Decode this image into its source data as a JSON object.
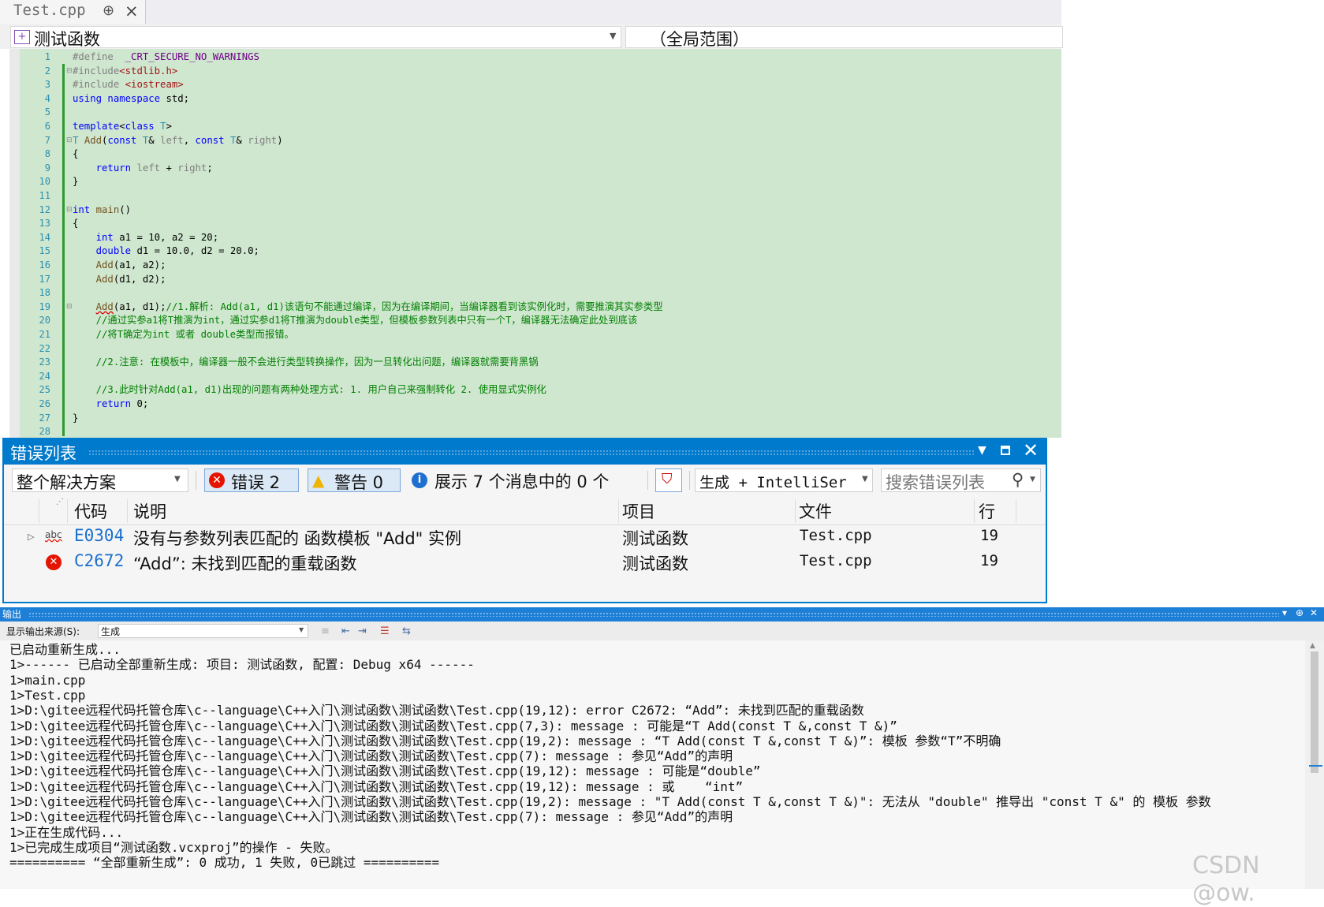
{
  "editor": {
    "tab_title": "Test.cpp",
    "tab_pin_icon": "pin-icon",
    "tab_close_icon": "close-icon",
    "nav_left": "测试函数",
    "nav_right": "（全局范围）",
    "line_numbers": [
      "1",
      "2",
      "3",
      "4",
      "5",
      "6",
      "7",
      "8",
      "9",
      "10",
      "11",
      "12",
      "13",
      "14",
      "15",
      "16",
      "17",
      "18",
      "19",
      "20",
      "21",
      "22",
      "23",
      "24",
      "25",
      "26",
      "27",
      "28"
    ]
  },
  "error_list": {
    "title": "错误列表",
    "scope": "整个解决方案",
    "errors_label": "错误 2",
    "warnings_label": "警告 0",
    "messages_label": "展示 7 个消息中的 0 个",
    "build_filter": "生成 + IntelliSer",
    "search_placeholder": "搜索错误列表",
    "columns": [
      "代码",
      "说明",
      "项目",
      "文件",
      "行"
    ],
    "rows": [
      {
        "code": "E0304",
        "desc": "没有与参数列表匹配的 函数模板 \"Add\" 实例",
        "project": "测试函数",
        "file": "Test.cpp",
        "line": "19"
      },
      {
        "code": "C2672",
        "desc": "“Add”: 未找到匹配的重载函数",
        "project": "测试函数",
        "file": "Test.cpp",
        "line": "19"
      }
    ]
  },
  "output": {
    "title": "输出",
    "source_label": "显示输出来源(S):",
    "source_value": "生成",
    "lines": [
      "已启动重新生成...",
      "1>------ 已启动全部重新生成: 项目: 测试函数, 配置: Debug x64 ------",
      "1>main.cpp",
      "1>Test.cpp",
      "1>D:\\gitee远程代码托管仓库\\c--language\\C++入门\\测试函数\\测试函数\\Test.cpp(19,12): error C2672: “Add”: 未找到匹配的重载函数",
      "1>D:\\gitee远程代码托管仓库\\c--language\\C++入门\\测试函数\\测试函数\\Test.cpp(7,3): message : 可能是“T Add(const T &,const T &)”",
      "1>D:\\gitee远程代码托管仓库\\c--language\\C++入门\\测试函数\\测试函数\\Test.cpp(19,2): message : “T Add(const T &,const T &)”: 模板 参数“T”不明确",
      "1>D:\\gitee远程代码托管仓库\\c--language\\C++入门\\测试函数\\测试函数\\Test.cpp(7): message : 参见“Add”的声明",
      "1>D:\\gitee远程代码托管仓库\\c--language\\C++入门\\测试函数\\测试函数\\Test.cpp(19,12): message : 可能是“double”",
      "1>D:\\gitee远程代码托管仓库\\c--language\\C++入门\\测试函数\\测试函数\\Test.cpp(19,12): message : 或    “int”",
      "1>D:\\gitee远程代码托管仓库\\c--language\\C++入门\\测试函数\\测试函数\\Test.cpp(19,2): message : \"T Add(const T &,const T &)\": 无法从 \"double\" 推导出 \"const T &\" 的 模板 参数",
      "1>D:\\gitee远程代码托管仓库\\c--language\\C++入门\\测试函数\\测试函数\\Test.cpp(7): message : 参见“Add”的声明",
      "1>正在生成代码...",
      "1>已完成生成项目“测试函数.vcxproj”的操作 - 失败。",
      "========== “全部重新生成”: 0 成功, 1 失败, 0已跳过 =========="
    ]
  },
  "watermark": "CSDN @ow."
}
